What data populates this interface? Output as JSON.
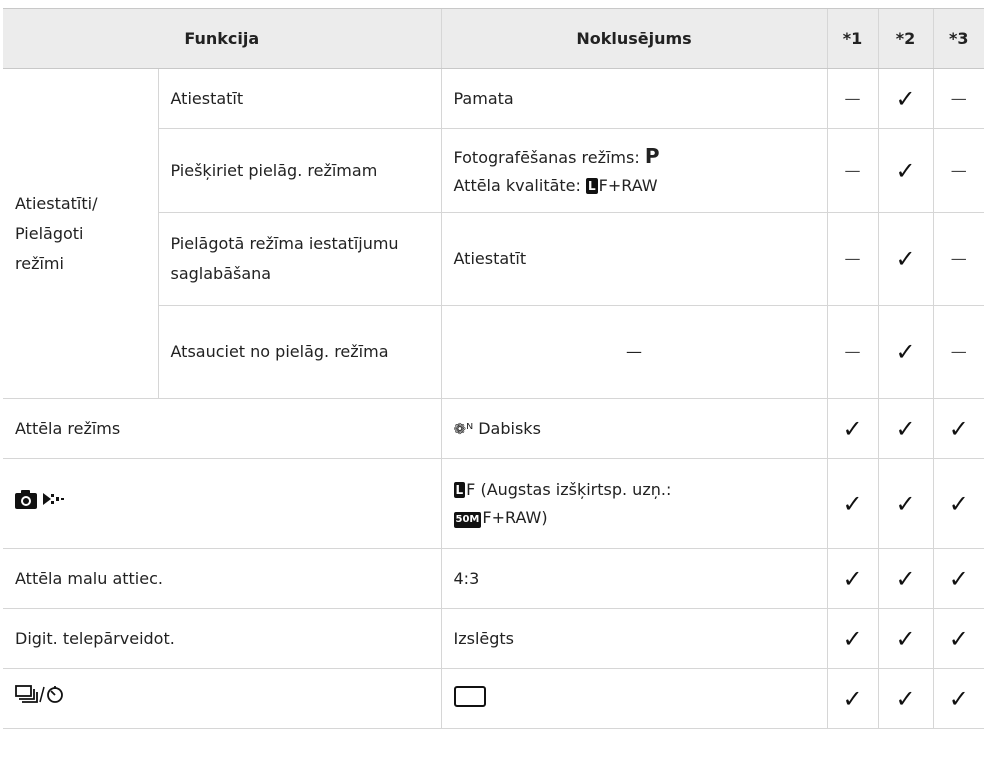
{
  "header": {
    "funkcija": "Funkcija",
    "noklusejums": "Noklusējums",
    "col1": "*1",
    "col2": "*2",
    "col3": "*3"
  },
  "group": {
    "label": "Atiestatīti/ Pielāgoti režīmi"
  },
  "rows": [
    {
      "name": "Atiestatīt",
      "value": "Pamata",
      "c1": "—",
      "c2": "✓",
      "c3": "—"
    },
    {
      "name": "Piešķiriet pielāg. režīmam",
      "value_l1": "Fotografēšanas režīms: ",
      "value_l1_icon": "P",
      "value_l2": "Attēla kvalitāte: ",
      "value_l2_icon": "L",
      "value_l2_rest": "F+RAW",
      "c1": "—",
      "c2": "✓",
      "c3": "—"
    },
    {
      "name": "Pielāgotā režīma iestatījumu saglabāšana",
      "value": "Atiestatīt",
      "c1": "—",
      "c2": "✓",
      "c3": "—"
    },
    {
      "name": "Atsauciet no pielāg. režīma",
      "value": "—",
      "c1": "—",
      "c2": "✓",
      "c3": "—"
    },
    {
      "name": "Attēla režīms",
      "value_icon": "natural-picture-mode-icon",
      "value": "Dabisks",
      "c1": "✓",
      "c2": "✓",
      "c3": "✓"
    },
    {
      "name_icon": "camera-settings-icon",
      "value_icon": "L",
      "value_l1": "F (Augstas izšķirtsp. uzņ.:",
      "value_l2_icon": "50M",
      "value_l2": "F+RAW)",
      "c1": "✓",
      "c2": "✓",
      "c3": "✓"
    },
    {
      "name": "Attēla malu attiec.",
      "value": "4:3",
      "c1": "✓",
      "c2": "✓",
      "c3": "✓"
    },
    {
      "name": "Digit. telepārveidot.",
      "value": "Izslēgts",
      "c1": "✓",
      "c2": "✓",
      "c3": "✓"
    },
    {
      "name_icon": "drive-self-timer-icon",
      "value_icon": "single-frame-icon",
      "c1": "✓",
      "c2": "✓",
      "c3": "✓"
    }
  ]
}
